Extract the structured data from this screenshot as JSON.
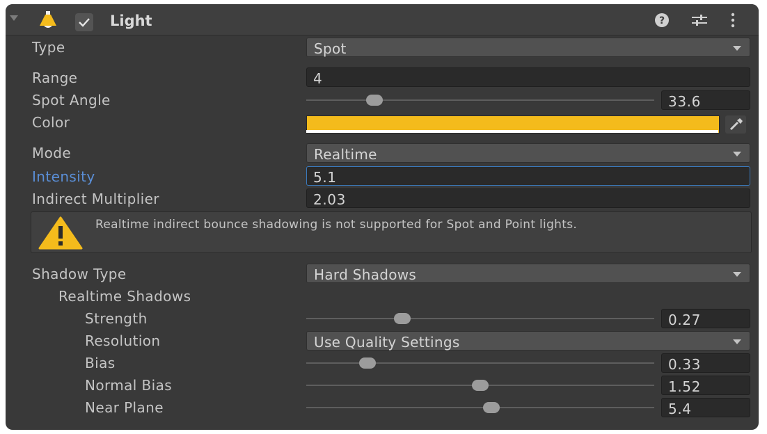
{
  "component": {
    "title": "Light",
    "enabled": true
  },
  "header": {
    "icons": [
      "help-icon",
      "presets-icon",
      "more-icon"
    ]
  },
  "rows": {
    "type": {
      "label": "Type",
      "value": "Spot"
    },
    "range": {
      "label": "Range",
      "value": "4"
    },
    "spot_angle": {
      "label": "Spot Angle",
      "value": "33.6"
    },
    "color": {
      "label": "Color",
      "value": "#F4BB1C"
    },
    "mode": {
      "label": "Mode",
      "value": "Realtime"
    },
    "intensity": {
      "label": "Intensity",
      "value": "5.1"
    },
    "indirect_multiplier": {
      "label": "Indirect Multiplier",
      "value": "2.03"
    },
    "warning": {
      "text": "Realtime indirect bounce shadowing is not supported for Spot and Point lights."
    },
    "shadow_type": {
      "label": "Shadow Type",
      "value": "Hard Shadows"
    },
    "realtime_shadows": {
      "label": "Realtime Shadows"
    },
    "strength": {
      "label": "Strength",
      "value": "0.27"
    },
    "resolution": {
      "label": "Resolution",
      "value": "Use Quality Settings"
    },
    "bias": {
      "label": "Bias",
      "value": "0.33"
    },
    "normal_bias": {
      "label": "Normal Bias",
      "value": "1.52"
    },
    "near_plane": {
      "label": "Near Plane",
      "value": "5.4"
    }
  },
  "colors": {
    "panel": "#393939",
    "accent": "#5A8ED6",
    "light_color": "#F4BB1C"
  }
}
